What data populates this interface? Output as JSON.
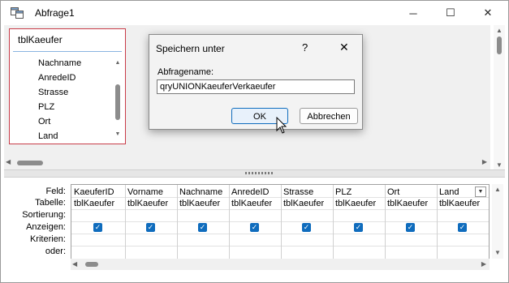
{
  "window": {
    "title": "Abfrage1",
    "app_icon": "query-design-icon",
    "controls": {
      "minimize": "─",
      "maximize": "☐",
      "close": "✕"
    }
  },
  "table_box": {
    "title": "tblKaeufer",
    "fields": [
      "Nachname",
      "AnredeID",
      "Strasse",
      "PLZ",
      "Ort",
      "Land"
    ]
  },
  "grid": {
    "row_labels": [
      "Feld:",
      "Tabelle:",
      "Sortierung:",
      "Anzeigen:",
      "Kriterien:",
      "oder:"
    ],
    "columns": [
      {
        "field": "KaeuferID",
        "table": "tblKaeufer",
        "show": true
      },
      {
        "field": "Vorname",
        "table": "tblKaeufer",
        "show": true
      },
      {
        "field": "Nachname",
        "table": "tblKaeufer",
        "show": true
      },
      {
        "field": "AnredeID",
        "table": "tblKaeufer",
        "show": true
      },
      {
        "field": "Strasse",
        "table": "tblKaeufer",
        "show": true
      },
      {
        "field": "PLZ",
        "table": "tblKaeufer",
        "show": true
      },
      {
        "field": "Ort",
        "table": "tblKaeufer",
        "show": true
      },
      {
        "field": "Land",
        "table": "tblKaeufer",
        "show": true
      }
    ]
  },
  "dialog": {
    "title": "Speichern unter",
    "help": "?",
    "close": "✕",
    "label": "Abfragename:",
    "input_value": "qryUNIONKaeuferVerkaeufer",
    "ok_label": "OK",
    "cancel_label": "Abbrechen"
  },
  "colors": {
    "accent": "#0f6cbd",
    "table_border": "#c83c48"
  }
}
